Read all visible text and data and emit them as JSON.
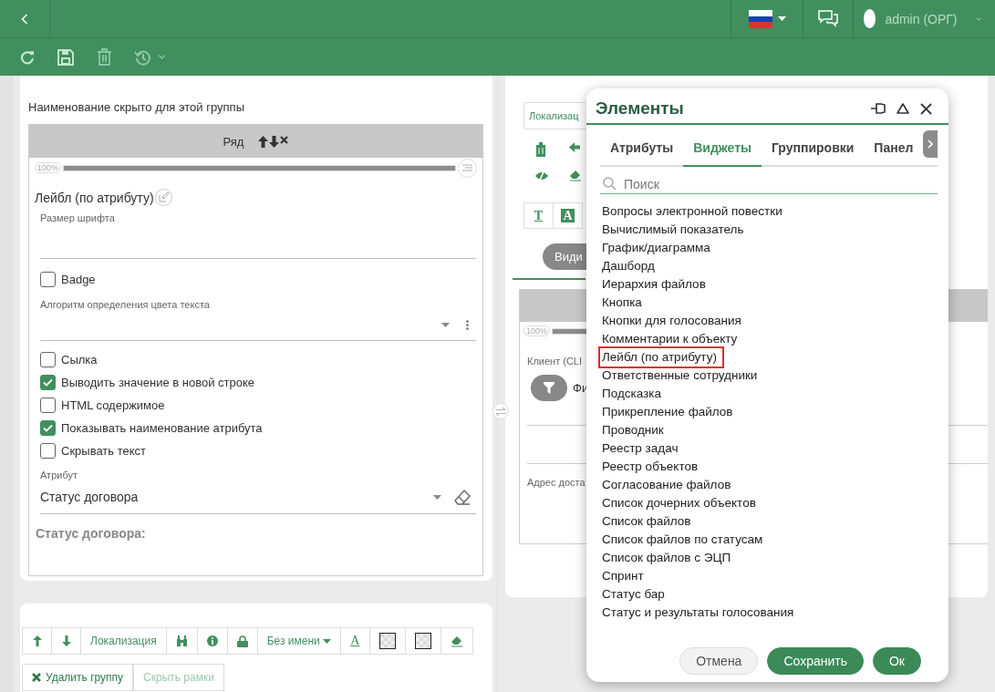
{
  "header": {
    "user": "admin (ОРГ)"
  },
  "group": {
    "caption": "Наименование скрыто для этой группы",
    "row_title": "Ряд",
    "width": {
      "reading": "100%",
      "level": 1
    },
    "widget_title": "Лейбл (по атрибуту)",
    "font_size": {
      "label": "Размер шрифта"
    },
    "badge": {
      "label": "Badge",
      "checked": false
    },
    "color_algorithm": {
      "label": "Алгоритм определения цвета текста"
    },
    "options": [
      {
        "label": "Сылка",
        "checked": false
      },
      {
        "label": "Выводить значение в новой строке",
        "checked": true
      },
      {
        "label": "HTML содержимое",
        "checked": false
      },
      {
        "label": "Показывать наименование атрибута",
        "checked": true
      },
      {
        "label": "Скрывать текст",
        "checked": false
      }
    ],
    "attribute": {
      "label": "Атрибут",
      "value": "Статус договора"
    },
    "preview": "Статус договора:"
  },
  "group_toolbar": {
    "localization": "Локализация",
    "name_menu": "Без имени",
    "text_color_glyph": "A",
    "actions": [
      {
        "label": "Удалить группу",
        "disabled": false
      },
      {
        "label": "Скрыть рамки",
        "disabled": true
      }
    ]
  },
  "right_panel": {
    "localization": "Локализац",
    "text_glyph": "T",
    "bg_glyph": "A",
    "view_tab": "Види",
    "width": {
      "reading": "100%",
      "level": 1
    },
    "field_label": "Клиент (CLI",
    "filter_text": "Фи",
    "address_label": "Адрес доста"
  },
  "dialog": {
    "title": "Элементы",
    "tabs": [
      {
        "label": "Атрибуты",
        "selected": false
      },
      {
        "label": "Виджеты",
        "selected": true
      },
      {
        "label": "Группировки",
        "selected": false
      },
      {
        "label": "Панел",
        "selected": false
      }
    ],
    "search": {
      "placeholder": "Поиск"
    },
    "items": [
      {
        "label": "Вопросы электронной повестки",
        "selected": false
      },
      {
        "label": "Вычислимый показатель",
        "selected": false
      },
      {
        "label": "График/диаграмма",
        "selected": false
      },
      {
        "label": "Дашборд",
        "selected": false
      },
      {
        "label": "Иерархия файлов",
        "selected": false
      },
      {
        "label": "Кнопка",
        "selected": false
      },
      {
        "label": "Кнопки для голосования",
        "selected": false
      },
      {
        "label": "Комментарии к объекту",
        "selected": false
      },
      {
        "label": "Лейбл (по атрибуту)",
        "selected": true
      },
      {
        "label": "Ответственные сотрудники",
        "selected": false
      },
      {
        "label": "Подсказка",
        "selected": false
      },
      {
        "label": "Прикрепление файлов",
        "selected": false
      },
      {
        "label": "Проводник",
        "selected": false
      },
      {
        "label": "Реестр задач",
        "selected": false
      },
      {
        "label": "Реестр объектов",
        "selected": false
      },
      {
        "label": "Согласование файлов",
        "selected": false
      },
      {
        "label": "Список дочерних объектов",
        "selected": false
      },
      {
        "label": "Список файлов",
        "selected": false
      },
      {
        "label": "Список файлов по статусам",
        "selected": false
      },
      {
        "label": "Список файлов с ЭЦП",
        "selected": false
      },
      {
        "label": "Спринт",
        "selected": false
      },
      {
        "label": "Статус бар",
        "selected": false
      },
      {
        "label": "Статус и результаты голосования",
        "selected": false
      }
    ],
    "buttons": [
      {
        "label": "Отмена",
        "kind": "secondary"
      },
      {
        "label": "Сохранить",
        "kind": "primary"
      },
      {
        "label": "Ок",
        "kind": "primary"
      }
    ]
  }
}
